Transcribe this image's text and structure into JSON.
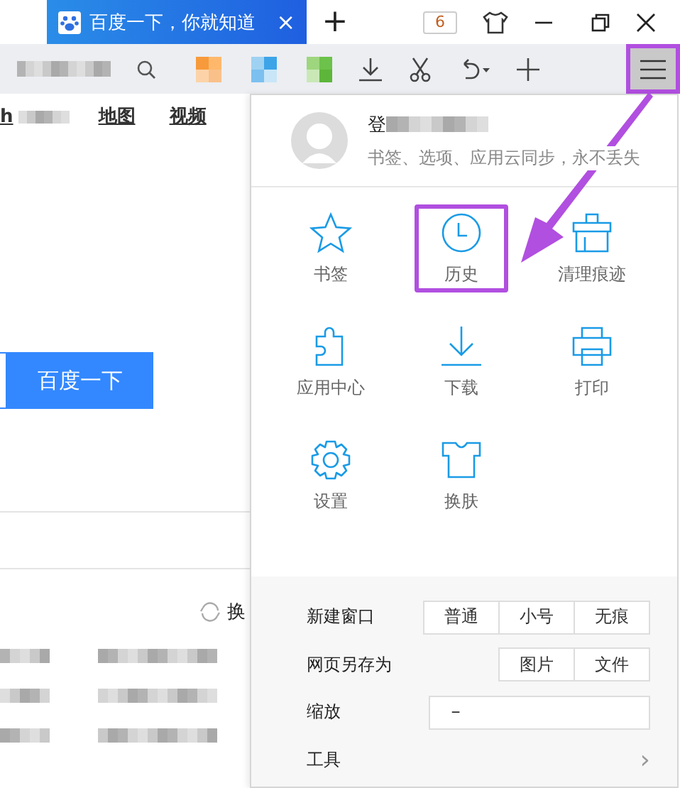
{
  "tab": {
    "title": "百度一下，你就知道",
    "close": "×"
  },
  "new_tab": "+",
  "tab_count": "6",
  "menu_button": {
    "annotated": true
  },
  "page": {
    "first_link": "h",
    "nav_links": [
      {
        "label": "地图"
      },
      {
        "label": "视频"
      }
    ],
    "search_button": "百度一下",
    "refresh_label": "换"
  },
  "menu": {
    "login_prefix": "登",
    "login_hint": "书签、选项、应用云同步，永不丢失",
    "items": [
      {
        "label": "书签",
        "kind": "star",
        "annotated": false
      },
      {
        "label": "历史",
        "kind": "clock",
        "annotated": true
      },
      {
        "label": "清理痕迹",
        "kind": "broom",
        "annotated": false
      },
      {
        "label": "应用中心",
        "kind": "puzzle",
        "annotated": false
      },
      {
        "label": "下载",
        "kind": "download",
        "annotated": false
      },
      {
        "label": "打印",
        "kind": "printer",
        "annotated": false
      },
      {
        "label": "设置",
        "kind": "gear",
        "annotated": false
      },
      {
        "label": "换肤",
        "kind": "shirt",
        "annotated": false
      }
    ],
    "rows": [
      {
        "kind": "options",
        "label": "新建窗口",
        "options": [
          "普通",
          "小号",
          "无痕"
        ]
      },
      {
        "kind": "options",
        "label": "网页另存为",
        "options": [
          "图片",
          "文件"
        ]
      },
      {
        "kind": "zoom",
        "label": "缩放",
        "minus": "－"
      },
      {
        "kind": "submenu",
        "label": "工具",
        "arrow": "›"
      }
    ]
  }
}
